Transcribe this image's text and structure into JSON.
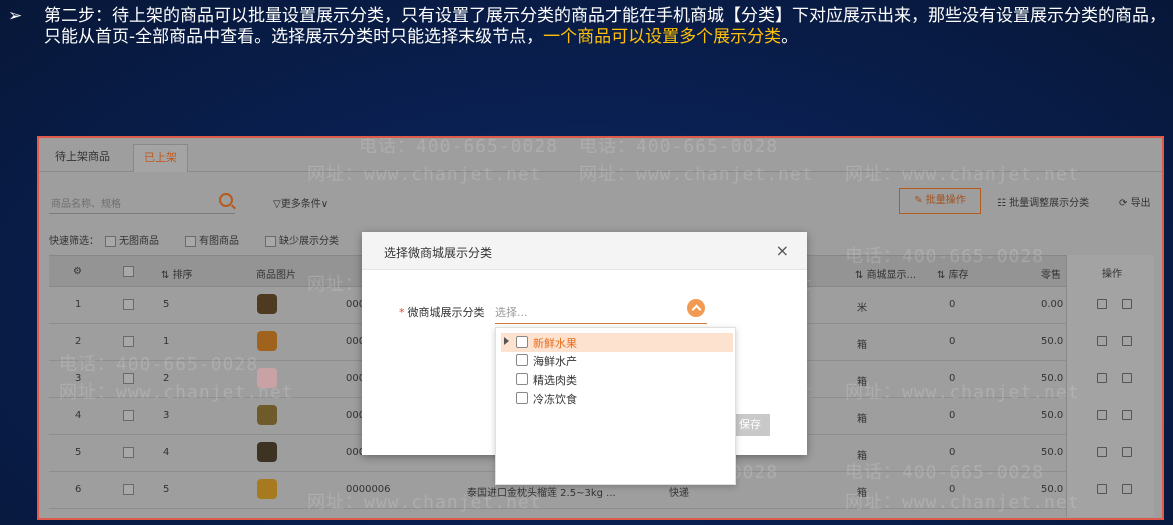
{
  "instruction": {
    "bullet": "➢",
    "text": "第二步：待上架的商品可以批量设置展示分类，只有设置了展示分类的商品才能在手机商城【分类】下对应展示出来，那些没有设置展示分类的商品，只能从首页-全部商品中查看。选择展示分类时只能选择末级节点，",
    "highlight": "一个商品可以设置多个展示分类",
    "end": "。"
  },
  "tabs": [
    "待上架商品",
    "已上架"
  ],
  "search": {
    "placeholder": "商品名称、规格"
  },
  "more_filters": "▽更多条件∨",
  "quick_filter": {
    "label": "快速筛选：",
    "options": [
      "无图商品",
      "有图商品",
      "缺少展示分类"
    ]
  },
  "toolbar": {
    "batch": "批量操作",
    "adjust": "批量调整展示分类",
    "export": "导出"
  },
  "table": {
    "headers": {
      "sort": "排序",
      "image": "商品图片",
      "display": "商城显示...",
      "stock": "库存",
      "price": "零售",
      "ops": "操作"
    },
    "rows": [
      {
        "idx": "1",
        "sort": "5",
        "code": "000",
        "unit": "米",
        "stock": "0",
        "price": "0.00"
      },
      {
        "idx": "2",
        "sort": "1",
        "code": "000",
        "unit": "箱",
        "stock": "0",
        "price": "50.0"
      },
      {
        "idx": "3",
        "sort": "2",
        "code": "000",
        "unit": "箱",
        "stock": "0",
        "price": "50.0"
      },
      {
        "idx": "4",
        "sort": "3",
        "code": "000",
        "unit": "箱",
        "stock": "0",
        "price": "50.0"
      },
      {
        "idx": "5",
        "sort": "4",
        "code": "000",
        "unit": "箱",
        "stock": "0",
        "price": "50.0"
      },
      {
        "idx": "6",
        "sort": "5",
        "code": "0000006",
        "unit": "箱",
        "stock": "0",
        "price": "50.0",
        "name": "泰国进口金枕头榴莲 2.5~3kg ...",
        "delivery": "快递"
      }
    ]
  },
  "modal": {
    "title": "选择微商城展示分类",
    "close": "×",
    "field_label": "微商城展示分类",
    "required": "*",
    "placeholder": "选择...",
    "save": "保存"
  },
  "dropdown": {
    "items": [
      {
        "label": "新鲜水果",
        "selected": true
      },
      {
        "label": "海鲜水产",
        "selected": false
      },
      {
        "label": "精选肉类",
        "selected": false
      },
      {
        "label": "冷冻饮食",
        "selected": false
      }
    ]
  },
  "watermark": {
    "phone": "电话：400-665-0028",
    "site": "网址：www.chanjet.net"
  },
  "colors": {
    "accent": "#f39a52",
    "highlight": "#ffc107",
    "frame": "#e05a4c"
  }
}
